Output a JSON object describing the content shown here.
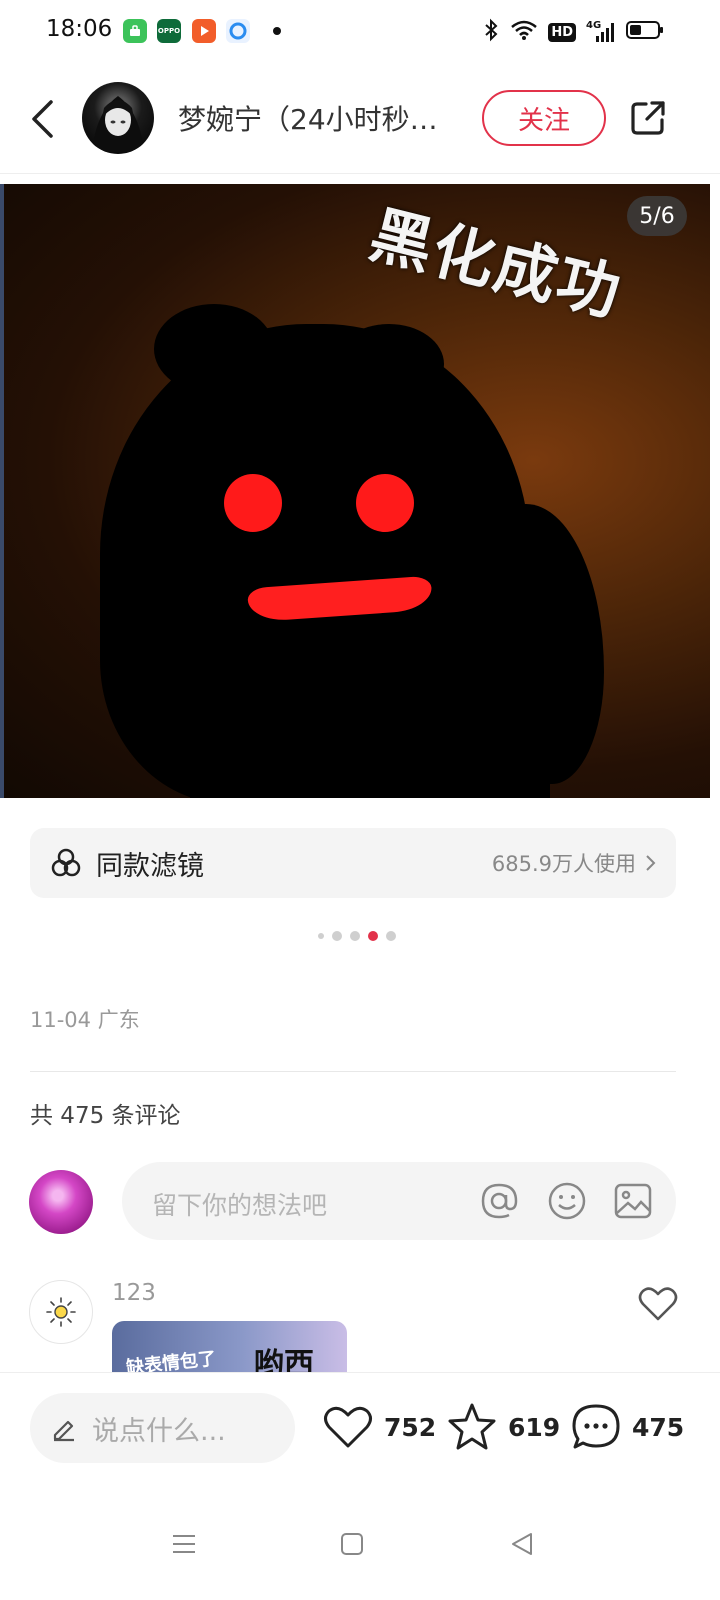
{
  "status_bar": {
    "time": "18:06",
    "icons": [
      "app-icon-green",
      "app-icon-oppo",
      "app-icon-video",
      "app-icon-browser",
      "bluetooth-icon",
      "wifi-icon",
      "hd-icon",
      "4g-signal-icon",
      "battery-icon"
    ],
    "app_oppo_text": "OPPO",
    "hd_text": "HD",
    "net_text": "4G"
  },
  "header": {
    "author_name": "梦婉宁（24小时秒…",
    "follow_label": "关注"
  },
  "photo": {
    "caption": "黑化成功",
    "page_indicator": "5/6",
    "watermark_id": "1857470175"
  },
  "filter": {
    "label": "同款滤镜",
    "usage": "685.9万人使用"
  },
  "carousel": {
    "total": 5,
    "active_index": 3
  },
  "post": {
    "date_location": "11-04 广东",
    "comment_total_text": "共 475 条评论"
  },
  "comment_input": {
    "placeholder": "留下你的想法吧"
  },
  "comments": [
    {
      "username": "123",
      "image_text_left": "缺表情包了",
      "image_text_right": "哟西"
    }
  ],
  "bottom_bar": {
    "say_placeholder": "说点什么...",
    "likes": "752",
    "favorites": "619",
    "comments": "475"
  },
  "colors": {
    "accent": "#e2324a",
    "muted_text": "#999999",
    "surface": "#f4f4f4"
  }
}
